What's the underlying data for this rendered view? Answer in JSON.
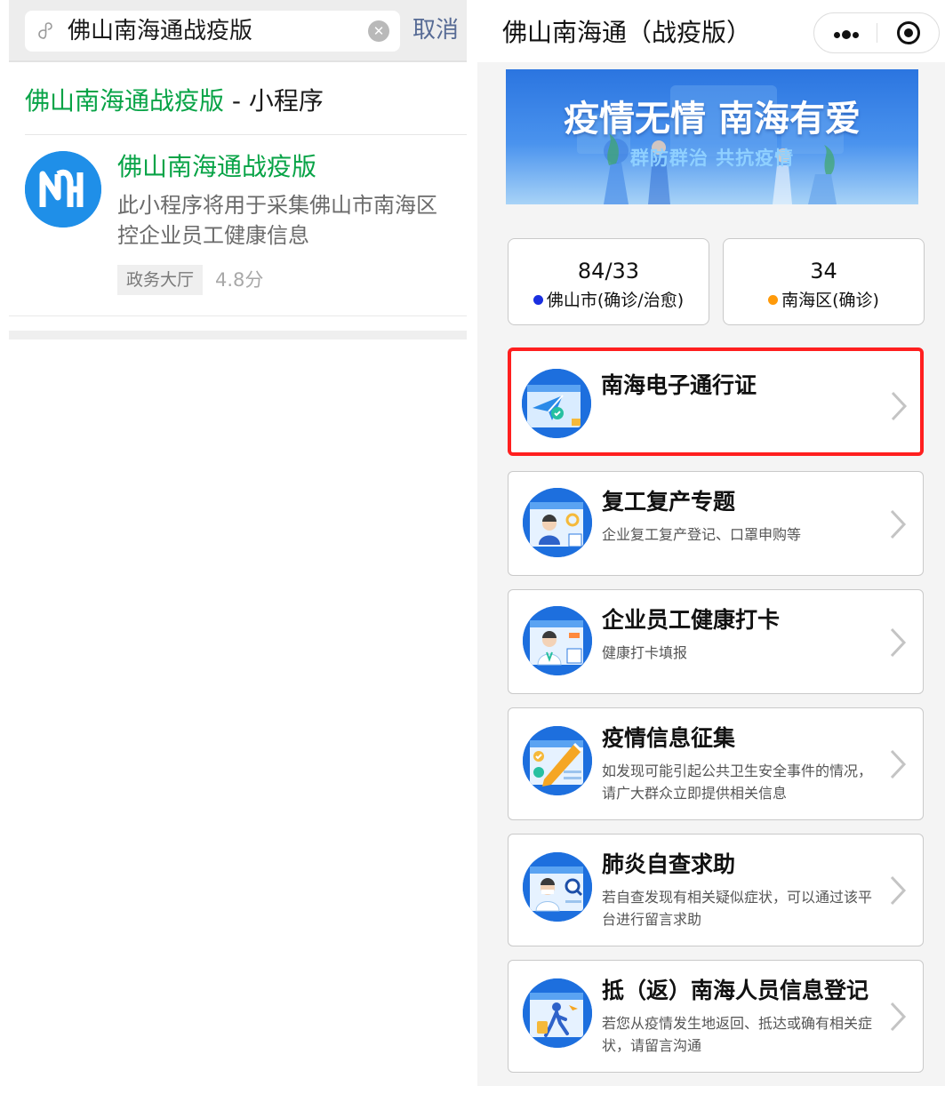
{
  "left": {
    "search": {
      "query": "佛山南海通战疫版",
      "cancel": "取消"
    },
    "result_header": {
      "name": "佛山南海通战疫版",
      "suffix": " - 小程序"
    },
    "app": {
      "logo_text": "NH",
      "name": "佛山南海通战疫版",
      "description": "此小程序将用于采集佛山市南海区控企业员工健康信息",
      "tag": "政务大厅",
      "score": "4.8分"
    }
  },
  "right": {
    "nav_title": "佛山南海通（战疫版）",
    "banner": {
      "title": "疫情无情 南海有爱",
      "subtitle": "群防群治 共抗疫情"
    },
    "stats": [
      {
        "value": "84/33",
        "label": "佛山市(确诊/治愈)",
        "dot_color": "#1a2fe0"
      },
      {
        "value": "34",
        "label": "南海区(确诊)",
        "dot_color": "#ff9a0a"
      }
    ],
    "menu": [
      {
        "title": "南海电子通行证",
        "desc": "",
        "highlighted": true,
        "icon": "paper-plane-pass-icon"
      },
      {
        "title": "复工复产专题",
        "desc": "企业复工复产登记、口罩申购等",
        "highlighted": false,
        "icon": "worker-resume-icon"
      },
      {
        "title": "企业员工健康打卡",
        "desc": "健康打卡填报",
        "highlighted": false,
        "icon": "doctor-checkin-icon"
      },
      {
        "title": "疫情信息征集",
        "desc": "如发现可能引起公共卫生安全事件的情况，请广大群众立即提供相关信息",
        "highlighted": false,
        "icon": "pencil-checklist-icon"
      },
      {
        "title": "肺炎自查求助",
        "desc": "若自查发现有相关疑似症状，可以通过该平台进行留言求助",
        "highlighted": false,
        "icon": "doctor-search-icon"
      },
      {
        "title": "抵（返）南海人员信息登记",
        "desc": "若您从疫情发生地返回、抵达或确有相关症状，请留言沟通",
        "highlighted": false,
        "icon": "traveler-register-icon"
      }
    ]
  },
  "colors": {
    "wechat_green": "#07a346",
    "wechat_link_blue": "#576b95",
    "highlight_red": "#ff1f1f",
    "brand_blue": "#1f8fe8"
  }
}
